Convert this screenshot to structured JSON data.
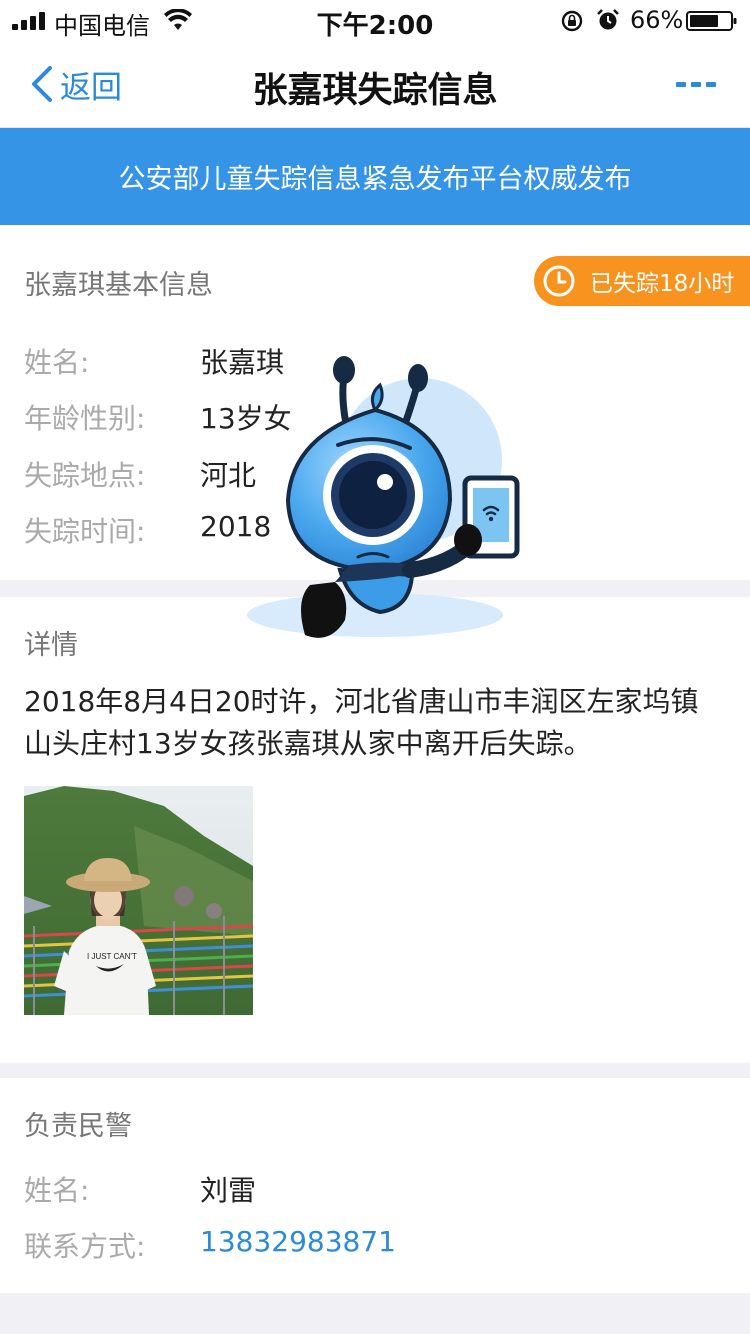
{
  "status_bar": {
    "carrier": "中国电信",
    "time": "下午2:00",
    "battery_pct": "66%"
  },
  "nav": {
    "back_label": "返回",
    "title": "张嘉琪失踪信息"
  },
  "banner": {
    "text": "公安部儿童失踪信息紧急发布平台权威发布"
  },
  "basic": {
    "title": "张嘉琪基本信息",
    "badge": "已失踪18小时",
    "rows": [
      {
        "label": "姓名:",
        "value": "张嘉琪"
      },
      {
        "label": "年龄性别:",
        "value": "13岁女"
      },
      {
        "label": "失踪地点:",
        "value": "河北"
      },
      {
        "label": "失踪时间:",
        "value": "2018"
      }
    ]
  },
  "detail": {
    "title": "详情",
    "text": "2018年8月4日20时许，河北省唐山市丰润区左家坞镇山头庄村13岁女孩张嘉琪从家中离开后失踪。",
    "photo_shirt_text": "I JUST CAN'T"
  },
  "police": {
    "title": "负责民警",
    "rows": [
      {
        "label": "姓名:",
        "value": "刘雷"
      },
      {
        "label": "联系方式:",
        "value": "13832983871"
      }
    ]
  },
  "colors": {
    "accent": "#3594e6",
    "link": "#2b8ad9",
    "badge": "#f7931e"
  },
  "icons": [
    "signal-icon",
    "wifi-icon",
    "rotation-lock-icon",
    "alarm-icon",
    "battery-icon",
    "back-chevron-icon",
    "more-icon",
    "clock-icon",
    "mascot-illustration"
  ]
}
